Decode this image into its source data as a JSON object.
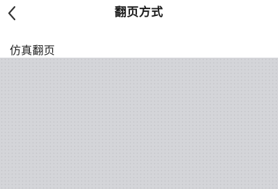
{
  "nav": {
    "back_icon": "chevron-left-icon",
    "title": "翻页方式"
  },
  "options": [
    {
      "label": "仿真翻页"
    }
  ],
  "colors": {
    "overlay": "#d4d5d9",
    "background": "#ffffff",
    "text": "#1e1e1e"
  }
}
